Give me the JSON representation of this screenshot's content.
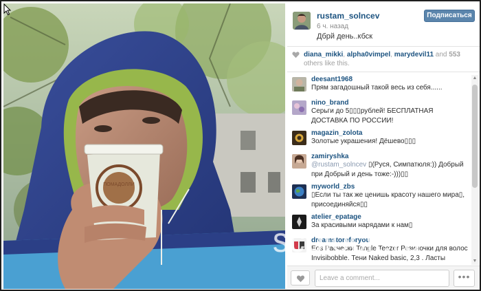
{
  "post": {
    "username": "rustam_solncev",
    "time_ago": "6 ч. назад",
    "caption": "Дбрй день..кбск",
    "follow_label": "Подписаться",
    "cup_brand": "ПОМАДОЛЛИ"
  },
  "likes": {
    "users": [
      "diana_mikki",
      "alpha0vimpel",
      "marydevil11"
    ],
    "separator": ", ",
    "and_text": " and ",
    "count": "553",
    "tail": " others like this."
  },
  "comments": [
    {
      "user": "deesant1968",
      "text": "Прям загадошный такой весь из себя......"
    },
    {
      "user": "nino_brand",
      "text": "Серьги до 5▯▯▯рублей! БЕСПЛАТНАЯ ДОСТАВКА ПО РОССИИ!"
    },
    {
      "user": "magazin_zolota",
      "text": "Золотые украшения! Дёшево▯▯▯"
    },
    {
      "user": "zamiryshka",
      "mention": "@rustam_solncev",
      "text": " ▯(Руся, Симпатюля:)) Добрый при Добрый и день тоже:-)))▯▯"
    },
    {
      "user": "myworld_zbs",
      "text": "▯Если ты так же ценишь красоту нашего мира▯, присоединяйся▯▯"
    },
    {
      "user": "atelier_epatage",
      "text": "За красивыми нарядами к нам▯"
    },
    {
      "user": "dreamstoreforyou",
      "text": "Eos Расчески Tangle Teezer Резиночки для волос Invisibobble. Тени Naked basic, 2,3 . Ласты"
    }
  ],
  "footer": {
    "comment_placeholder": "Leave a comment...",
    "more_label": "•••"
  },
  "watermark": "scblock.ru",
  "colors": {
    "link": "#1c5380",
    "follow_button": "#5b85ac",
    "muted": "#a0a0a0"
  },
  "icons": {
    "like": "heart-icon",
    "more": "ellipsis-icon",
    "cursor": "mouse-pointer-icon"
  }
}
